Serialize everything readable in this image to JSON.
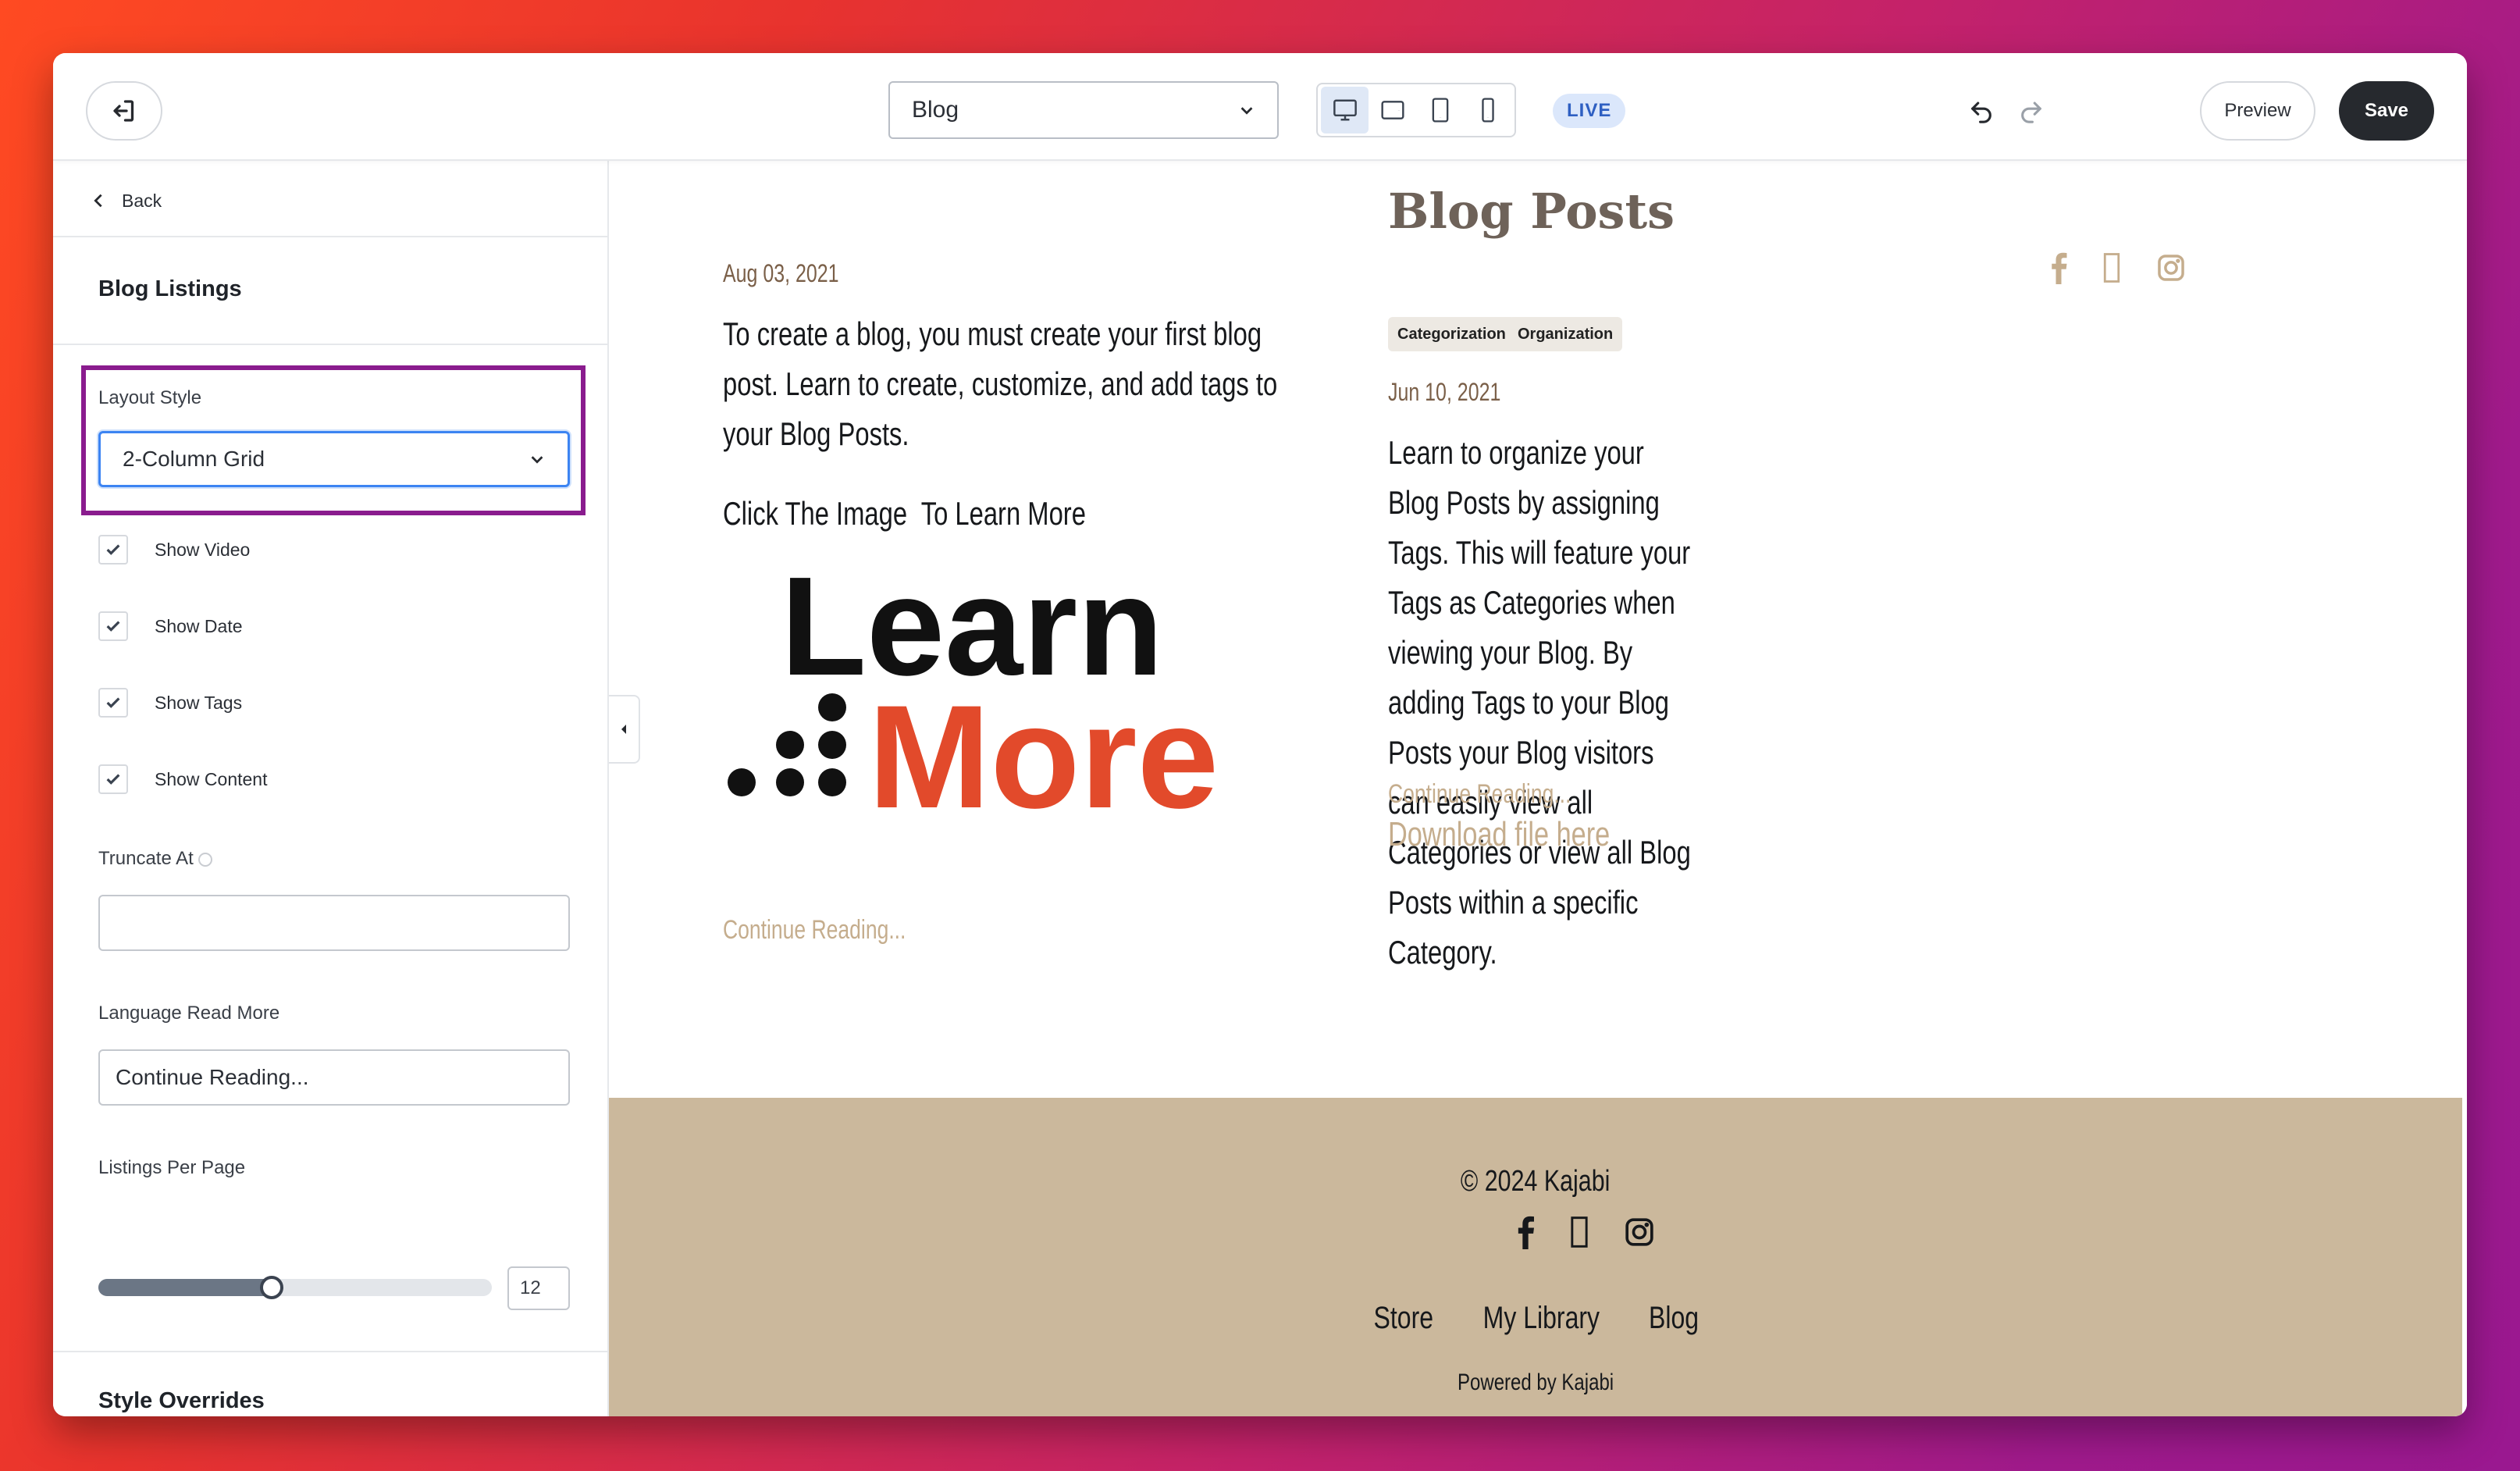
{
  "topbar": {
    "exit_icon": "exit-icon",
    "page_select": {
      "value": "Blog",
      "options": [
        "Blog"
      ]
    },
    "devices": [
      "desktop-icon",
      "tablet-landscape-icon",
      "tablet-portrait-icon",
      "mobile-icon"
    ],
    "active_device": "desktop",
    "live_label": "LIVE",
    "preview_label": "Preview",
    "save_label": "Save"
  },
  "sidebar": {
    "back_label": "Back",
    "section_title": "Blog Listings",
    "layout_style": {
      "label": "Layout Style",
      "value": "2-Column Grid",
      "options": [
        "2-Column Grid"
      ]
    },
    "checkboxes": [
      {
        "label": "Show Video",
        "checked": true
      },
      {
        "label": "Show Date",
        "checked": true
      },
      {
        "label": "Show Tags",
        "checked": true
      },
      {
        "label": "Show Content",
        "checked": true
      }
    ],
    "truncate": {
      "label": "Truncate At",
      "value": ""
    },
    "read_more": {
      "label": "Language Read More",
      "value": "Continue Reading..."
    },
    "listings_per_page": {
      "label": "Listings Per Page",
      "value": "12",
      "fraction": 0.44
    },
    "style_overrides_title": "Style Overrides"
  },
  "preview": {
    "post1": {
      "date": "Aug 03, 2021",
      "text": "To create a blog, you must create your first blog post. Learn to create, customize, and add tags to your Blog Posts.",
      "click_text": "Click The Image  To Learn More",
      "image_text_top": "Learn",
      "image_text_bottom": "More",
      "continue": "Continue Reading..."
    },
    "post2": {
      "title": "Blog Posts",
      "tags": [
        "Categorization",
        "Organization"
      ],
      "date": "Jun 10, 2021",
      "text": "Learn to organize your Blog Posts by assigning Tags. This will feature your Tags as Categories when viewing your Blog. By adding Tags to your Blog Posts your Blog visitors can easily view all Categories or view all Blog Posts within a specific Category.",
      "download": "Download file here",
      "continue": "Continue Reading..."
    },
    "side_social": [
      "facebook-icon",
      "unknown-icon",
      "instagram-icon"
    ],
    "footer": {
      "copyright": "© 2024 Kajabi",
      "social": [
        "facebook-icon",
        "unknown-icon",
        "instagram-icon"
      ],
      "nav": [
        "Store",
        "My Library",
        "Blog"
      ],
      "powered": "Powered by Kajabi"
    }
  },
  "colors": {
    "accent_highlight": "#8a1c8e",
    "link_tan": "#c5ad8d",
    "footer_bg": "#cbb89c",
    "save_bg": "#26292e",
    "learn_orange": "#e24a2b"
  }
}
